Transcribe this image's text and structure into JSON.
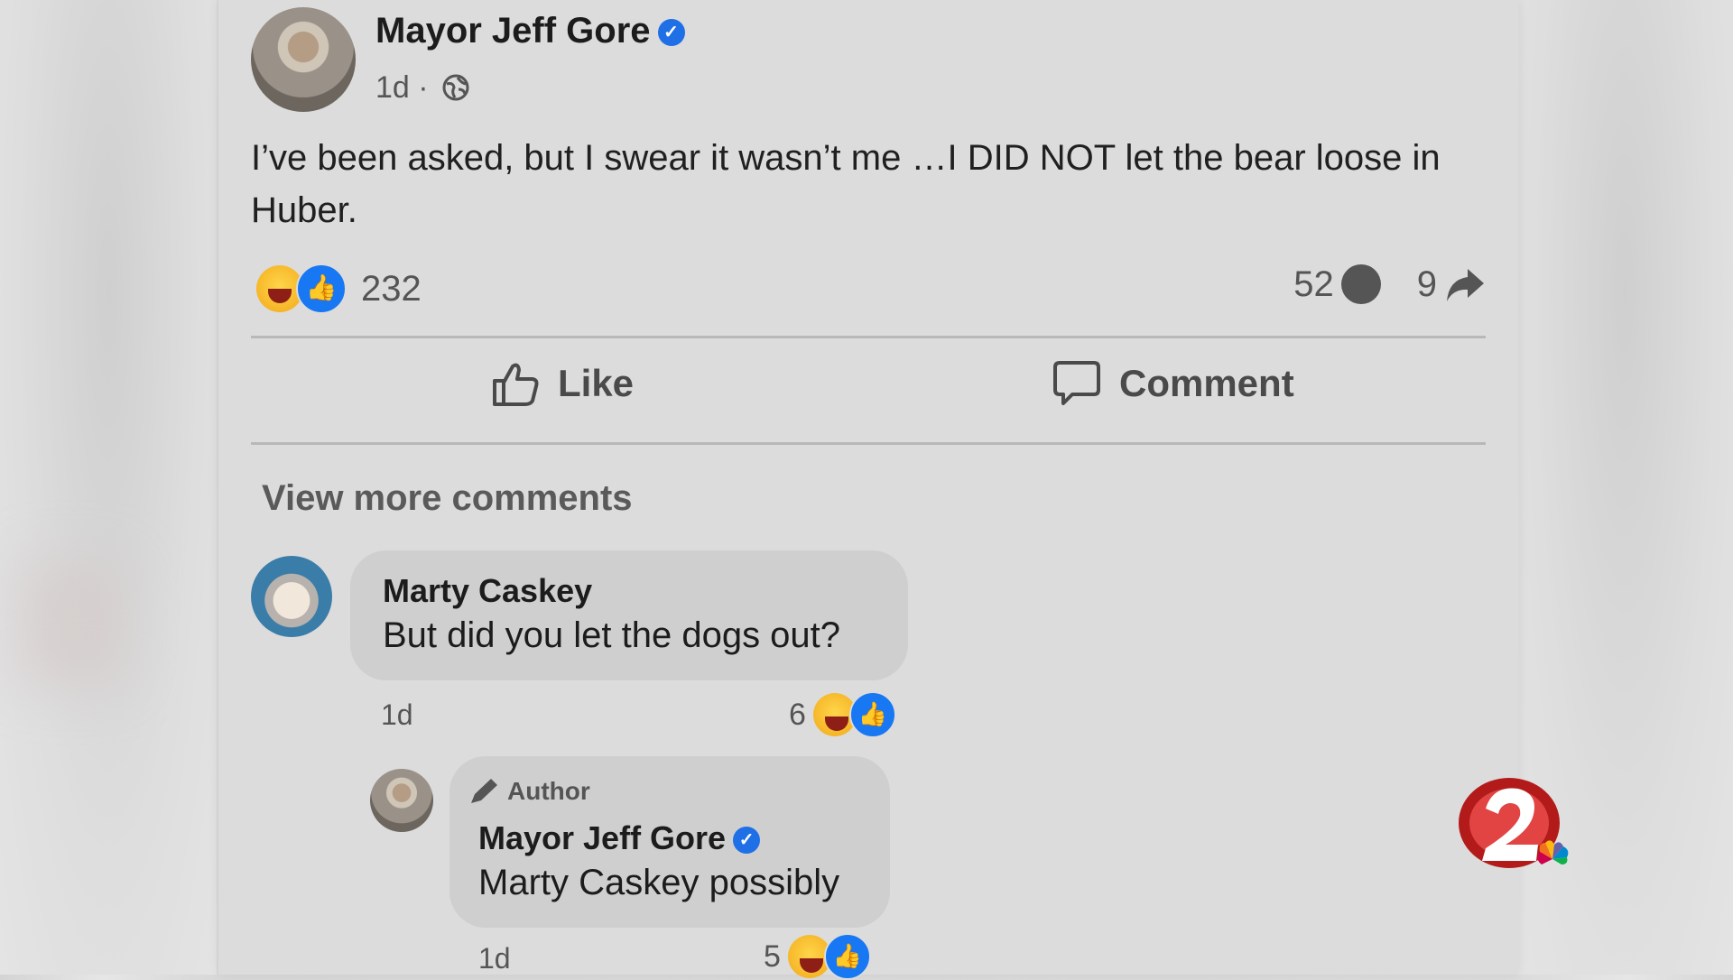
{
  "post": {
    "author": "Mayor Jeff Gore",
    "time": "1d ·",
    "text": "I’ve been asked, but I swear it wasn’t me …I DID NOT let the bear loose in Huber.",
    "reaction_count": "232",
    "comment_count": "52",
    "share_count": "9"
  },
  "actions": {
    "like": "Like",
    "comment": "Comment"
  },
  "view_more": "View more comments",
  "comments": [
    {
      "name": "Marty Caskey",
      "text": "But did you let the dogs out?",
      "time": "1d",
      "reactions": "6"
    },
    {
      "tag": "Author",
      "name": "Mayor Jeff Gore",
      "text": "Marty Caskey possibly",
      "time": "1d",
      "reactions": "5"
    }
  ],
  "icons": [
    "verified-badge-icon",
    "globe-icon",
    "haha-reaction-icon",
    "like-reaction-icon",
    "comment-bubble-icon",
    "share-arrow-icon",
    "thumbs-up-icon",
    "comment-icon",
    "pencil-icon",
    "channel-2-nbc-logo"
  ],
  "colors": {
    "accent": "#1877f2",
    "card": "#dcdcdc"
  }
}
